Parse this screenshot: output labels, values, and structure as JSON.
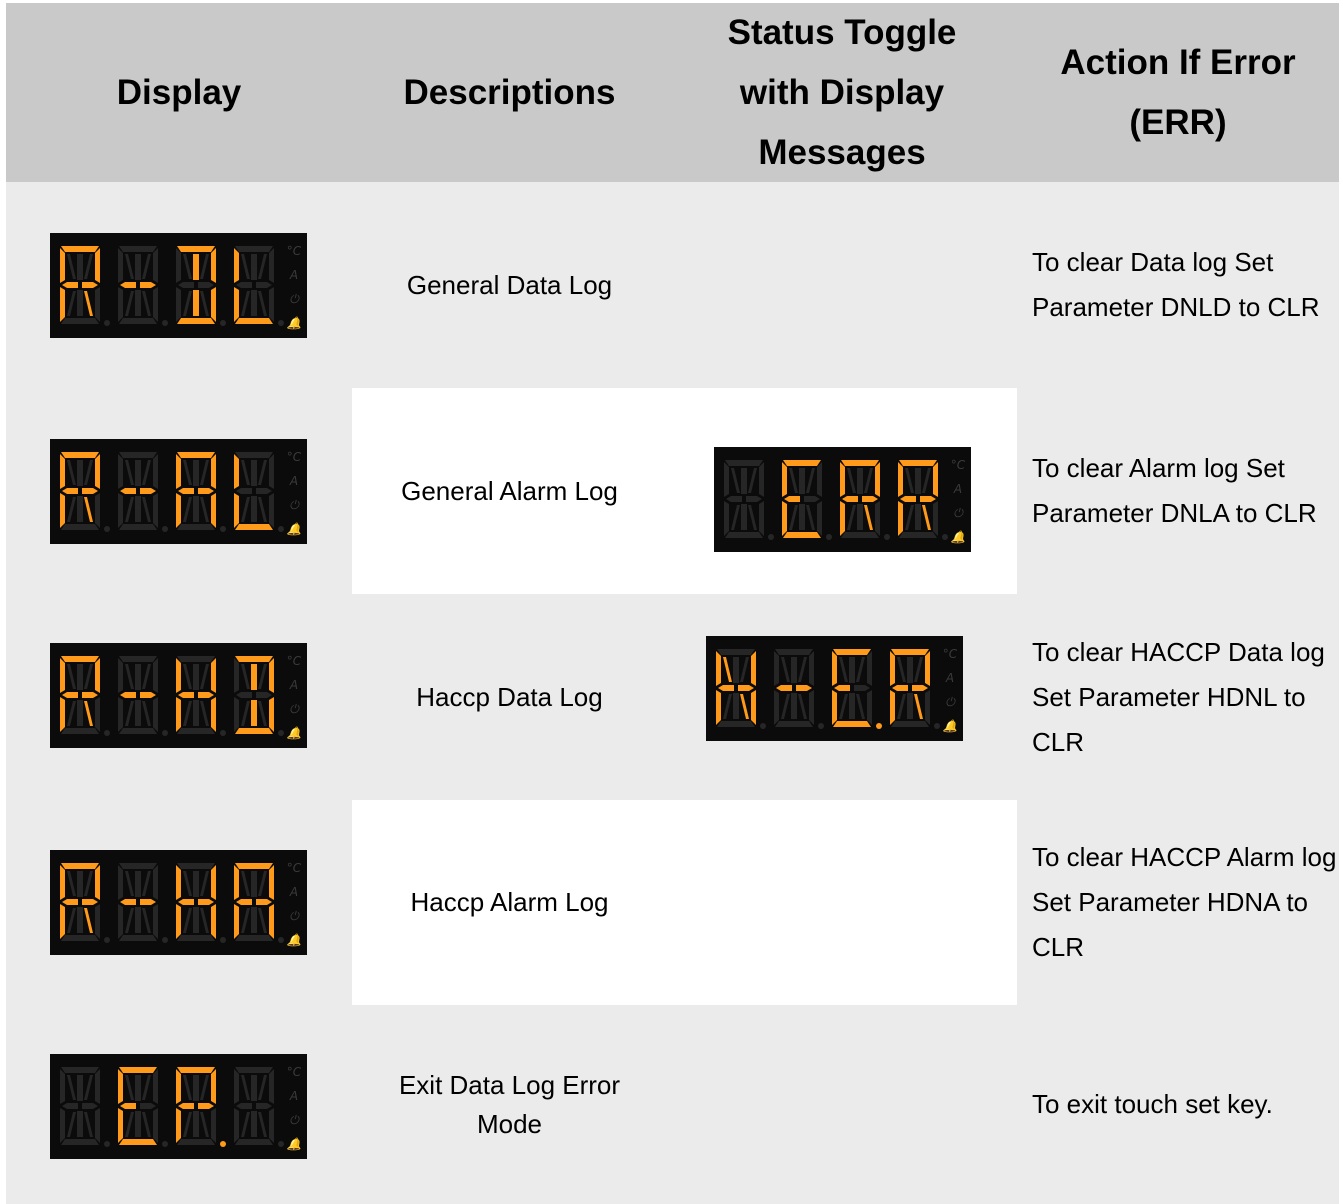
{
  "headers": {
    "display": "Display",
    "descriptions": "Descriptions",
    "status": "Status Toggle with Display Messages",
    "action": "Action If Error (ERR)"
  },
  "rows": [
    {
      "display_code": "R-DL",
      "description": "General Data Log",
      "action": "To clear Data log Set Parameter DNLD to CLR"
    },
    {
      "display_code": "R-AL",
      "description": "General Alarm Log",
      "action": "To clear Alarm log Set Parameter DNLA to CLR"
    },
    {
      "display_code": "R-HD",
      "description": "Haccp Data Log",
      "action": "To clear HACCP Data log Set Parameter HDNL to CLR"
    },
    {
      "display_code": "R-HA",
      "description": "Haccp Alarm Log",
      "action": "To clear HACCP Alarm log Set Parameter HDNA to CLR"
    },
    {
      "display_code": "EP.",
      "description": "Exit Data Log Error Mode",
      "action": "To exit touch set key."
    }
  ],
  "status_displays": [
    {
      "display_code": "ERR"
    },
    {
      "display_code": "H-ER"
    }
  ],
  "indicator_labels": [
    "°C",
    "A",
    "⏻",
    "🔔"
  ],
  "colors": {
    "segment_on": "#ff9a1a",
    "segment_off": "#262626",
    "panel_bg": "#0b0b0b",
    "header_bg": "#c9c9c9",
    "row_grey": "#ebebeb"
  }
}
